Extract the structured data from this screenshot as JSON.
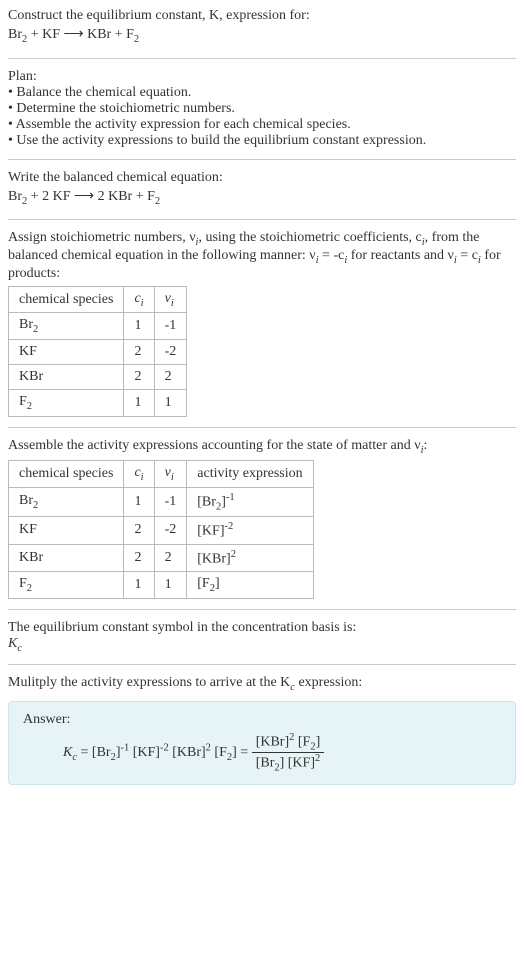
{
  "intro": {
    "line1": "Construct the equilibrium constant, K, expression for:",
    "eq": "Br",
    "eq2": " + KF ⟶ KBr + F"
  },
  "plan": {
    "header": "Plan:",
    "b1": "• Balance the chemical equation.",
    "b2": "• Determine the stoichiometric numbers.",
    "b3": "• Assemble the activity expression for each chemical species.",
    "b4": "• Use the activity expressions to build the equilibrium constant expression."
  },
  "balanced": {
    "header": "Write the balanced chemical equation:",
    "eq_pre": "Br",
    "eq_mid": " + 2 KF ⟶ 2 KBr + F"
  },
  "assign": {
    "text1": "Assign stoichiometric numbers, ν",
    "text2": ", using the stoichiometric coefficients, c",
    "text3": ", from the balanced chemical equation in the following manner: ν",
    "text4": " = -c",
    "text5": " for reactants and ν",
    "text6": " = c",
    "text7": " for products:",
    "table": {
      "h1": "chemical species",
      "h2": "c",
      "h3": "ν",
      "rows": [
        {
          "sp": "Br",
          "sub": "2",
          "c": "1",
          "v": "-1"
        },
        {
          "sp": "KF",
          "sub": "",
          "c": "2",
          "v": "-2"
        },
        {
          "sp": "KBr",
          "sub": "",
          "c": "2",
          "v": "2"
        },
        {
          "sp": "F",
          "sub": "2",
          "c": "1",
          "v": "1"
        }
      ]
    }
  },
  "activity": {
    "text1": "Assemble the activity expressions accounting for the state of matter and ν",
    "text2": ":",
    "table": {
      "h1": "chemical species",
      "h2": "c",
      "h3": "ν",
      "h4": "activity expression",
      "rows": [
        {
          "sp": "Br",
          "sub": "2",
          "c": "1",
          "v": "-1",
          "act_base": "[Br",
          "act_sub": "2",
          "act_close": "]",
          "act_exp": "-1"
        },
        {
          "sp": "KF",
          "sub": "",
          "c": "2",
          "v": "-2",
          "act_base": "[KF]",
          "act_sub": "",
          "act_close": "",
          "act_exp": "-2"
        },
        {
          "sp": "KBr",
          "sub": "",
          "c": "2",
          "v": "2",
          "act_base": "[KBr]",
          "act_sub": "",
          "act_close": "",
          "act_exp": "2"
        },
        {
          "sp": "F",
          "sub": "2",
          "c": "1",
          "v": "1",
          "act_base": "[F",
          "act_sub": "2",
          "act_close": "]",
          "act_exp": ""
        }
      ]
    }
  },
  "symbol": {
    "line1": "The equilibrium constant symbol in the concentration basis is:",
    "sym": "K",
    "sub": "c"
  },
  "multiply": {
    "line1": "Mulitply the activity expressions to arrive at the K",
    "line2": " expression:"
  },
  "answer": {
    "label": "Answer:",
    "k": "K",
    "ksub": "c",
    "eq": " = [Br",
    "t1": "]",
    "e1": "-1",
    "t2": " [KF]",
    "e2": "-2",
    "t3": " [KBr]",
    "e3": "2",
    "t4": " [F",
    "t5": "] = ",
    "num1": "[KBr]",
    "nume1": "2",
    "num2": " [F",
    "num3": "]",
    "den1": "[Br",
    "den2": "] [KF]",
    "dene2": "2"
  }
}
